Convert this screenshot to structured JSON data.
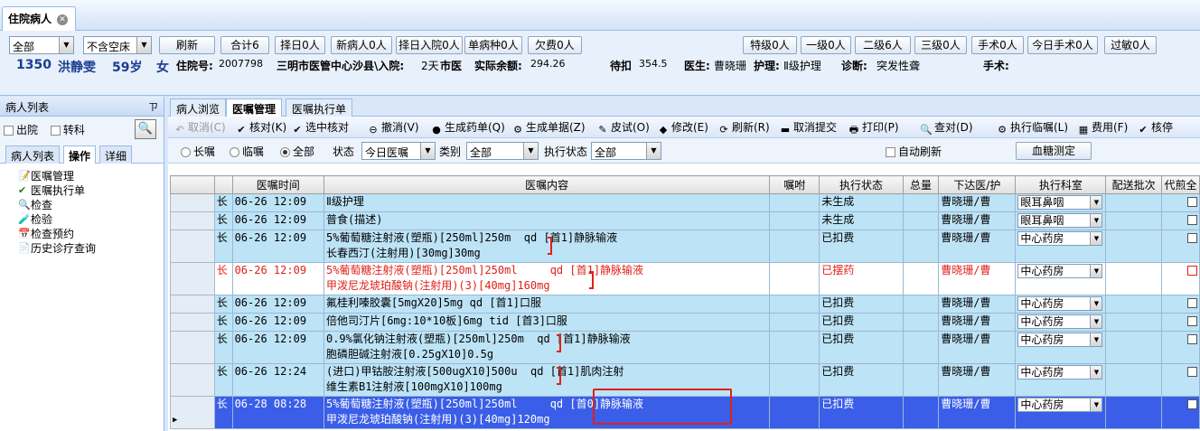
{
  "window": {
    "tab_title": "住院病人"
  },
  "header": {
    "filter1": "全部",
    "filter2": "不含空床",
    "buttons": [
      "刷新",
      "合计6",
      "择日0人",
      "新病人0人",
      "择日入院0人",
      "单病种0人",
      "欠费0人",
      "特级0人",
      "一级0人",
      "二级6人",
      "三级0人",
      "手术0人",
      "今日手术0人",
      "过敏0人"
    ],
    "patient": {
      "bed": "1350",
      "name": "洪静雯",
      "age": "59岁",
      "gender": "女",
      "inpatient_label": "住院号:",
      "inpatient_no": "2007798",
      "hospital": "三明市医管中心沙县\\入院:",
      "admit_days": "2天",
      "insurance": "市医",
      "balance_label": "实际余额:",
      "balance": "294.26",
      "pending_label": "待扣",
      "pending": "354.5",
      "doctor_label": "医生:",
      "doctor": "曹晓珊",
      "nursing_label": "护理:",
      "nursing": "Ⅱ级护理",
      "diagnosis_label": "诊断:",
      "diagnosis": "突发性聋",
      "surgery_label": "手术:"
    }
  },
  "left_panel": {
    "title": "病人列表",
    "pin": "ㄗ",
    "check_discharge": "出院",
    "check_transfer": "转科",
    "tabs": [
      "病人列表",
      "操作",
      "详细"
    ],
    "tree": [
      "医嘱管理",
      "医嘱执行单",
      "检查",
      "检验",
      "检查预约",
      "历史诊疗查询"
    ]
  },
  "right_panel": {
    "tabs": [
      "病人浏览",
      "医嘱管理",
      "医嘱执行单"
    ],
    "toolbar": [
      "取消(C)",
      "核对(K)",
      "选中核对",
      "撤消(V)",
      "生成药单(Q)",
      "生成单据(Z)",
      "皮试(O)",
      "修改(E)",
      "刷新(R)",
      "取消提交",
      "打印(P)",
      "查对(D)",
      "执行临嘱(L)",
      "费用(F)",
      "核停"
    ],
    "filter": {
      "radio_long": "长嘱",
      "radio_temp": "临嘱",
      "radio_all": "全部",
      "status_label": "状态",
      "status_value": "今日医嘱",
      "category_label": "类别",
      "category_value": "全部",
      "exec_status_label": "执行状态",
      "exec_status_value": "全部",
      "auto_refresh": "自动刷新",
      "blood_sugar_btn": "血糖测定"
    },
    "grid": {
      "columns": [
        "",
        "",
        "医嘱时间",
        "医嘱内容",
        "嘱咐",
        "执行状态",
        "总量",
        "下达医/护",
        "执行科室",
        "配送批次",
        "代煎全"
      ],
      "rows": [
        {
          "type": "长",
          "time": "06-26 12:09",
          "content": [
            "Ⅱ级护理"
          ],
          "status": "未生成",
          "doctor": "曹晓珊/曹",
          "dept": "眼耳鼻咽",
          "style": "blue-row"
        },
        {
          "type": "长",
          "time": "06-26 12:09",
          "content": [
            "普食(描述)"
          ],
          "status": "未生成",
          "doctor": "曹晓珊/曹",
          "dept": "眼耳鼻咽",
          "style": "blue-row"
        },
        {
          "type": "长",
          "time": "06-26 12:09",
          "content": [
            "5%葡萄糖注射液(塑瓶)[250ml]250m  qd [首1]静脉输液",
            "长春西汀(注射用)[30mg]30mg"
          ],
          "status": "已扣费",
          "doctor": "曹晓珊/曹",
          "dept": "中心药房",
          "style": "blue-row"
        },
        {
          "type": "长",
          "time": "06-26 12:09",
          "content": [
            "5%葡萄糖注射液(塑瓶)[250ml]250ml     qd [首1]静脉输液",
            "甲泼尼龙琥珀酸钠(注射用)(3)[40mg]160mg"
          ],
          "status": "已摆药",
          "doctor": "曹晓珊/曹",
          "dept": "中心药房",
          "style": "red-row"
        },
        {
          "type": "长",
          "time": "06-26 12:09",
          "content": [
            "氟桂利嗪胶囊[5mgX20]5mg qd [首1]口服"
          ],
          "status": "已扣费",
          "doctor": "曹晓珊/曹",
          "dept": "中心药房",
          "style": "blue-row"
        },
        {
          "type": "长",
          "time": "06-26 12:09",
          "content": [
            "倍他司汀片[6mg:10*10板]6mg tid [首3]口服"
          ],
          "status": "已扣费",
          "doctor": "曹晓珊/曹",
          "dept": "中心药房",
          "style": "blue-row"
        },
        {
          "type": "长",
          "time": "06-26 12:09",
          "content": [
            "0.9%氯化钠注射液(塑瓶)[250ml]250m  qd [首1]静脉输液",
            "胞磷胆碱注射液[0.25gX10]0.5g"
          ],
          "status": "已扣费",
          "doctor": "曹晓珊/曹",
          "dept": "中心药房",
          "style": "blue-row"
        },
        {
          "type": "长",
          "time": "06-26 12:24",
          "content": [
            "(进口)甲钴胺注射液[500ugX10]500u  qd [首1]肌肉注射",
            "维生素B1注射液[100mgX10]100mg"
          ],
          "status": "已扣费",
          "doctor": "曹晓珊/曹",
          "dept": "中心药房",
          "style": "blue-row"
        },
        {
          "type": "长",
          "time": "06-28 08:28",
          "content": [
            "5%葡萄糖注射液(塑瓶)[250ml]250ml     qd [首0]静脉输液",
            "甲泼尼龙琥珀酸钠(注射用)(3)[40mg]120mg"
          ],
          "status": "已扣费",
          "doctor": "曹晓珊/曹",
          "dept": "中心药房",
          "style": "sel-row"
        }
      ]
    }
  }
}
